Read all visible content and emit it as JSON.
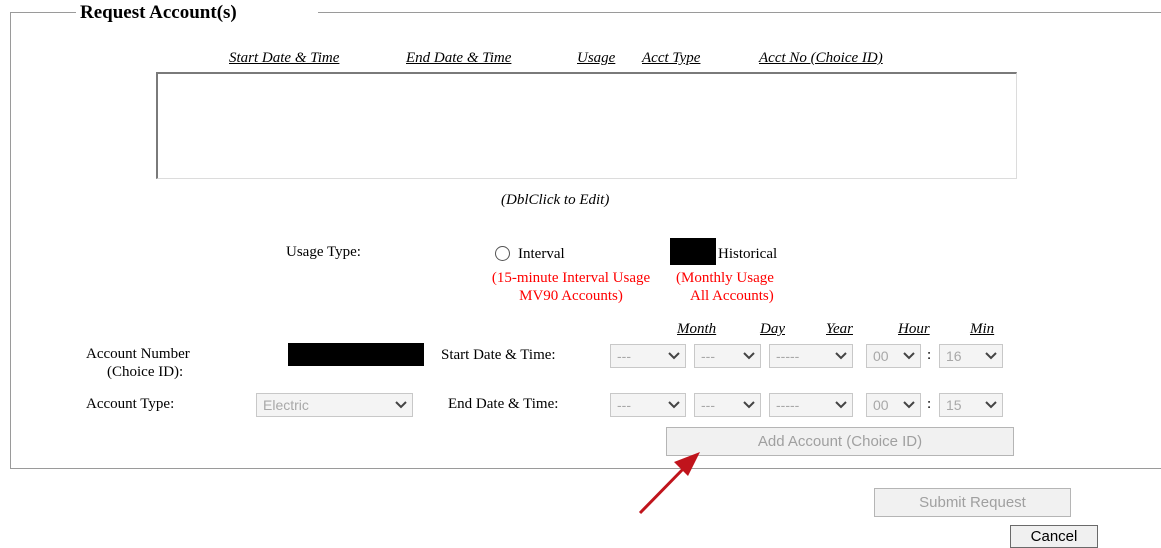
{
  "fieldset": {
    "legend": "Request Account(s)"
  },
  "grid": {
    "columns": [
      "Start Date & Time",
      "End Date & Time",
      "Usage",
      "Acct Type",
      "Acct No (Choice ID)"
    ],
    "hint": "(DblClick to Edit)"
  },
  "usage_type": {
    "label": "Usage Type:",
    "interval": {
      "label": "Interval",
      "note_line1": "(15-minute Interval Usage",
      "note_line2": "MV90 Accounts)"
    },
    "historical": {
      "label": "Historical",
      "note_line1": "(Monthly Usage",
      "note_line2": "All Accounts)"
    }
  },
  "date_headers": {
    "month": "Month",
    "day": "Day",
    "year": "Year",
    "hour": "Hour",
    "min": "Min"
  },
  "account_number": {
    "label_line1": "Account Number",
    "label_line2": "(Choice ID):"
  },
  "account_type": {
    "label": "Account Type:",
    "selected": "Electric"
  },
  "start": {
    "label": "Start Date & Time:",
    "month": "---",
    "day": "---",
    "year": "-----",
    "hour": "00",
    "min": "16",
    "sep": ":"
  },
  "end": {
    "label": "End Date & Time:",
    "month": "---",
    "day": "---",
    "year": "-----",
    "hour": "00",
    "min": "15",
    "sep": ":"
  },
  "buttons": {
    "add_account": "Add Account (Choice ID)",
    "submit": "Submit Request",
    "cancel": "Cancel"
  },
  "colors": {
    "note_red": "#ff0000",
    "arrow": "#c0141c",
    "disabled_text": "#a0a0a0"
  }
}
